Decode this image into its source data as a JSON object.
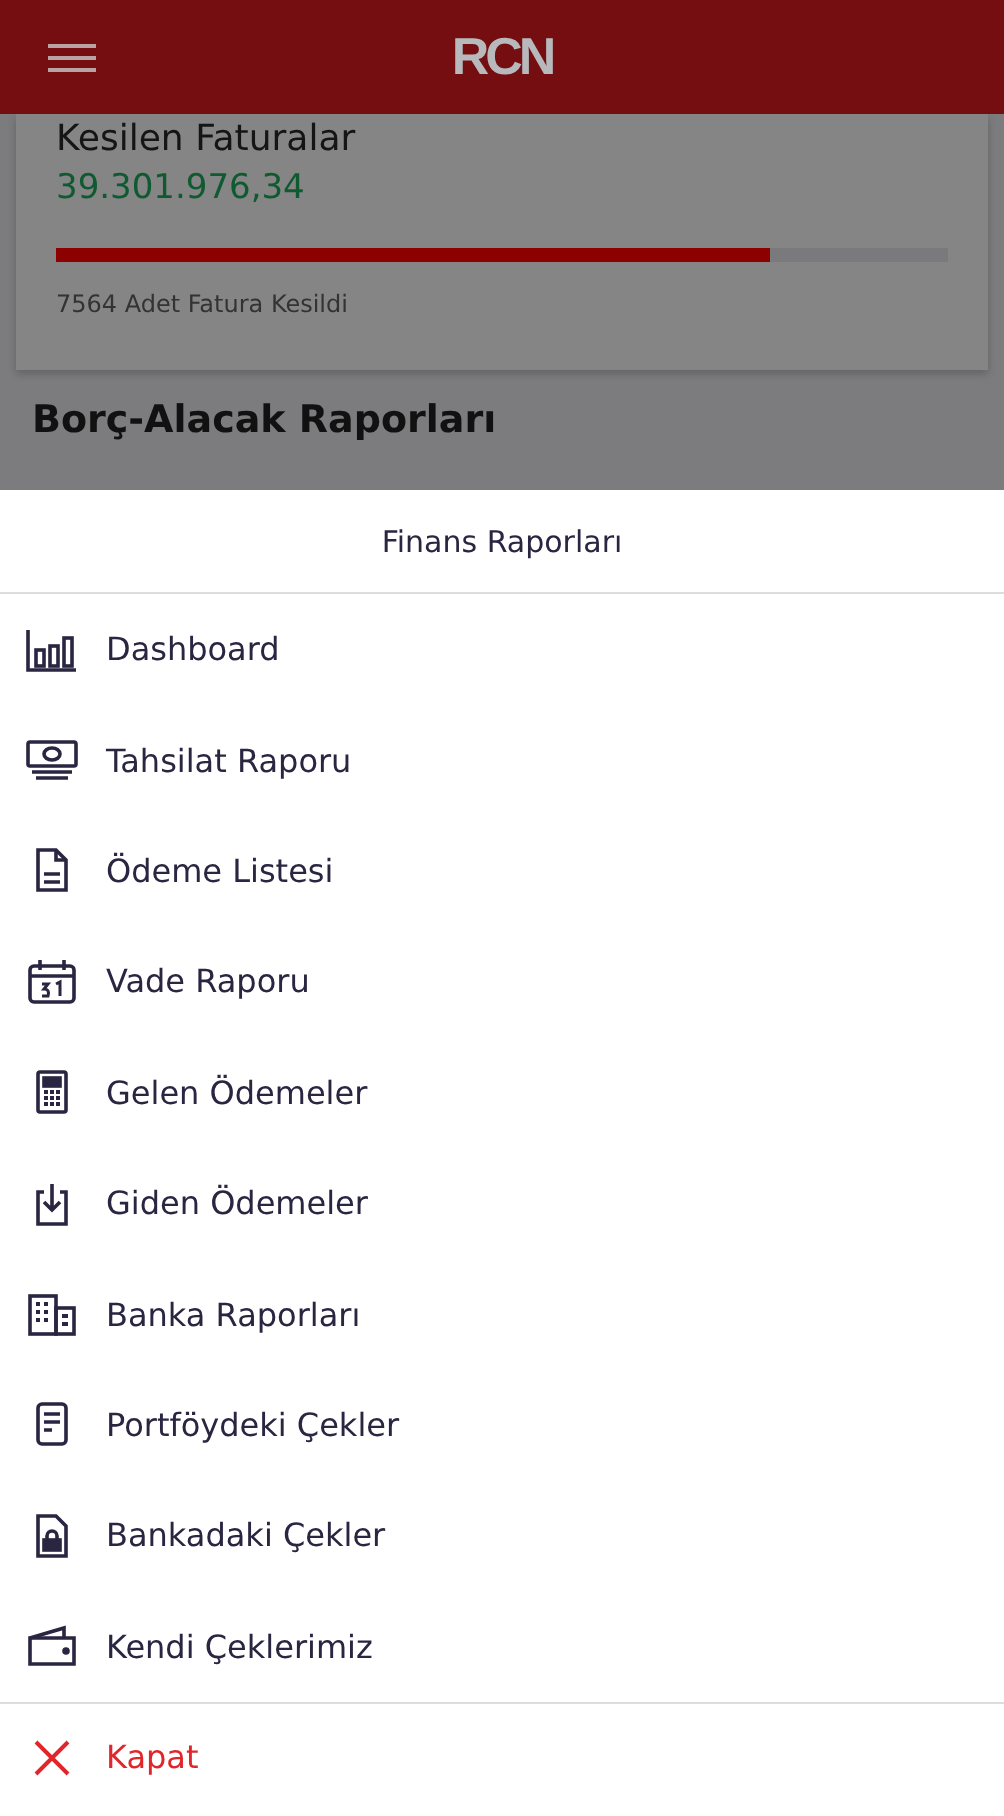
{
  "header": {
    "logo": "RCN"
  },
  "card": {
    "title": "Kesilen Faturalar",
    "amount": "39.301.976,34",
    "level": 0.8,
    "caption": "7564 Adet Fatura Kesildi"
  },
  "section_title": "Borç-Alacak Raporları",
  "sheet": {
    "title": "Finans Raporları",
    "items": [
      {
        "label": "Dashboard"
      },
      {
        "label": "Tahsilat Raporu"
      },
      {
        "label": "Ödeme Listesi"
      },
      {
        "label": "Vade Raporu"
      },
      {
        "label": "Gelen Ödemeler"
      },
      {
        "label": "Giden Ödemeler"
      },
      {
        "label": "Banka Raporları"
      },
      {
        "label": "Portföydeki Çekler"
      },
      {
        "label": "Bankadaki Çekler"
      },
      {
        "label": "Kendi Çeklerimiz"
      }
    ],
    "close": {
      "label": "Kapat"
    }
  }
}
